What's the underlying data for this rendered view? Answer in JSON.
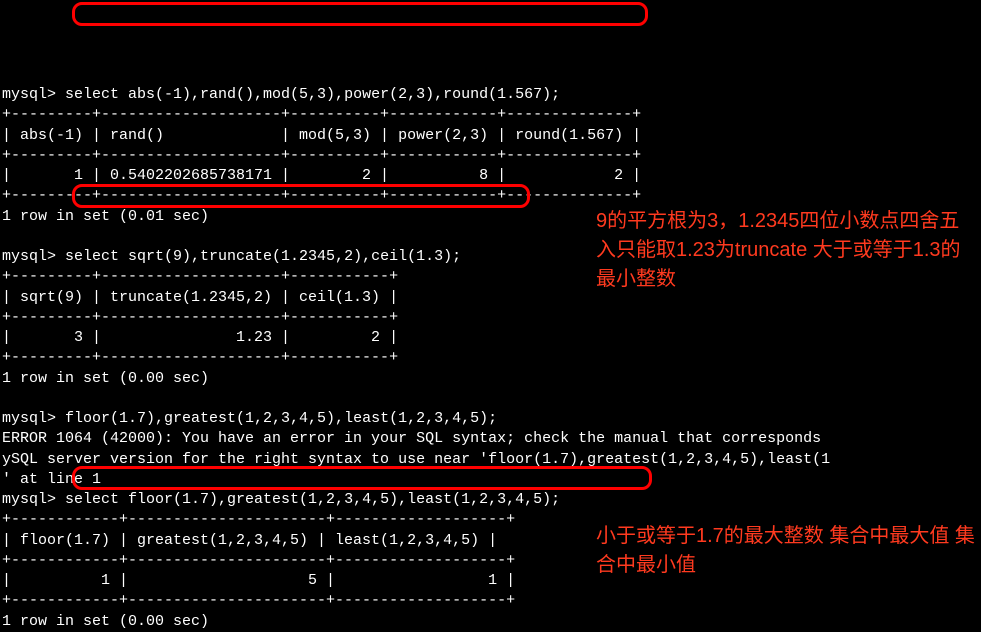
{
  "prompt": "mysql>",
  "block1": {
    "cmd": " select abs(-1),rand(),mod(5,3),power(2,3),round(1.567);",
    "sep": "+---------+--------------------+----------+------------+--------------+",
    "hdr": "| abs(-1) | rand()             | mod(5,3) | power(2,3) | round(1.567) |",
    "row": "|       1 | 0.5402202685738171 |        2 |          8 |            2 |",
    "status": "1 row in set (0.01 sec)"
  },
  "block2": {
    "cmd": " select sqrt(9),truncate(1.2345,2),ceil(1.3);",
    "sep": "+---------+--------------------+-----------+",
    "hdr": "| sqrt(9) | truncate(1.2345,2) | ceil(1.3) |",
    "row": "|       3 |               1.23 |         2 |",
    "status": "1 row in set (0.00 sec)"
  },
  "block3": {
    "err_cmd": " floor(1.7),greatest(1,2,3,4,5),least(1,2,3,4,5);",
    "err_line1": "ERROR 1064 (42000): You have an error in your SQL syntax; check the manual that corresponds ",
    "err_line2": "ySQL server version for the right syntax to use near 'floor(1.7),greatest(1,2,3,4,5),least(1",
    "err_line3": "' at line 1",
    "cmd": " select floor(1.7),greatest(1,2,3,4,5),least(1,2,3,4,5);",
    "sep": "+------------+----------------------+-------------------+",
    "hdr": "| floor(1.7) | greatest(1,2,3,4,5) | least(1,2,3,4,5) |",
    "row": "|          1 |                    5 |                 1 |",
    "status": "1 row in set (0.00 sec)"
  },
  "annotations": {
    "a1": "9的平方根为3，1.2345四位小数点四舍五入只能取1.23为truncate   大于或等于1.3的最小整数",
    "a2": "小于或等于1.7的最大整数\n集合中最大值\n集合中最小值"
  },
  "chart_data": [
    {
      "type": "table",
      "title": "select abs(-1),rand(),mod(5,3),power(2,3),round(1.567)",
      "columns": [
        "abs(-1)",
        "rand()",
        "mod(5,3)",
        "power(2,3)",
        "round(1.567)"
      ],
      "rows": [
        [
          1,
          0.5402202685738171,
          2,
          8,
          2
        ]
      ]
    },
    {
      "type": "table",
      "title": "select sqrt(9),truncate(1.2345,2),ceil(1.3)",
      "columns": [
        "sqrt(9)",
        "truncate(1.2345,2)",
        "ceil(1.3)"
      ],
      "rows": [
        [
          3,
          1.23,
          2
        ]
      ]
    },
    {
      "type": "table",
      "title": "select floor(1.7),greatest(1,2,3,4,5),least(1,2,3,4,5)",
      "columns": [
        "floor(1.7)",
        "greatest(1,2,3,4,5)",
        "least(1,2,3,4,5)"
      ],
      "rows": [
        [
          1,
          5,
          1
        ]
      ]
    }
  ]
}
